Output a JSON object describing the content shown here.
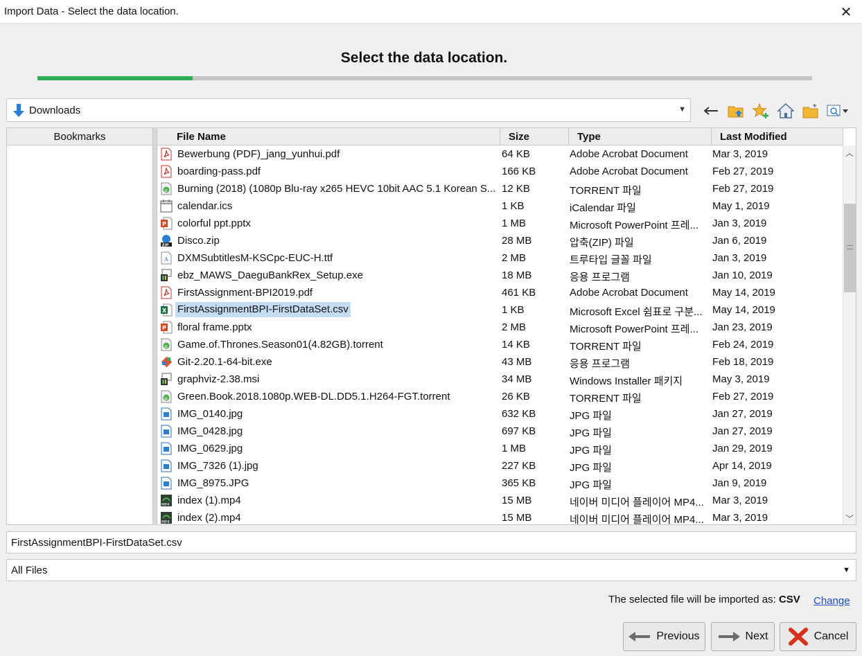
{
  "window": {
    "title": "Import Data - Select the data location."
  },
  "header": {
    "step_title": "Select the data location.",
    "progress_fraction": 0.2
  },
  "location": {
    "current": "Downloads"
  },
  "bookmarks": {
    "header": "Bookmarks"
  },
  "table": {
    "columns": [
      "File Name",
      "Size",
      "Type",
      "Last Modified"
    ],
    "rows": [
      {
        "name": "Bewerbung (PDF)_jang_yunhui.pdf",
        "size": "64 KB",
        "type": "Adobe Acrobat Document",
        "modified": "Mar 3, 2019",
        "icon": "pdf"
      },
      {
        "name": "boarding-pass.pdf",
        "size": "166 KB",
        "type": "Adobe Acrobat Document",
        "modified": "Feb 27, 2019",
        "icon": "pdf"
      },
      {
        "name": "Burning (2018) (1080p Blu-ray x265 HEVC 10bit AAC 5.1 Korean S...",
        "size": "12 KB",
        "type": "TORRENT 파일",
        "modified": "Feb 27, 2019",
        "icon": "torrent"
      },
      {
        "name": "calendar.ics",
        "size": "1 KB",
        "type": "iCalendar 파일",
        "modified": "May 1, 2019",
        "icon": "calendar"
      },
      {
        "name": "colorful ppt.pptx",
        "size": "1 MB",
        "type": "Microsoft PowerPoint 프레...",
        "modified": "Jan 3, 2019",
        "icon": "pptx"
      },
      {
        "name": "Disco.zip",
        "size": "28 MB",
        "type": "압축(ZIP) 파일",
        "modified": "Jan 6, 2019",
        "icon": "zip"
      },
      {
        "name": "DXMSubtitlesM-KSCpc-EUC-H.ttf",
        "size": "2 MB",
        "type": "트루타입 글꼴 파일",
        "modified": "Jan 3, 2019",
        "icon": "font"
      },
      {
        "name": "ebz_MAWS_DaeguBankRex_Setup.exe",
        "size": "18 MB",
        "type": "응용 프로그램",
        "modified": "Jan 10, 2019",
        "icon": "installer"
      },
      {
        "name": "FirstAssignment-BPI2019.pdf",
        "size": "461 KB",
        "type": "Adobe Acrobat Document",
        "modified": "May 14, 2019",
        "icon": "pdf"
      },
      {
        "name": "FirstAssignmentBPI-FirstDataSet.csv",
        "size": "1 KB",
        "type": "Microsoft Excel 쉼표로 구분...",
        "modified": "May 14, 2019",
        "icon": "csv",
        "selected": true
      },
      {
        "name": "floral frame.pptx",
        "size": "2 MB",
        "type": "Microsoft PowerPoint 프레...",
        "modified": "Jan 23, 2019",
        "icon": "pptx"
      },
      {
        "name": "Game.of.Thrones.Season01(4.82GB).torrent",
        "size": "14 KB",
        "type": "TORRENT 파일",
        "modified": "Feb 24, 2019",
        "icon": "torrent"
      },
      {
        "name": "Git-2.20.1-64-bit.exe",
        "size": "43 MB",
        "type": "응용 프로그램",
        "modified": "Feb 18, 2019",
        "icon": "git"
      },
      {
        "name": "graphviz-2.38.msi",
        "size": "34 MB",
        "type": "Windows Installer 패키지",
        "modified": "May 3, 2019",
        "icon": "installer"
      },
      {
        "name": "Green.Book.2018.1080p.WEB-DL.DD5.1.H264-FGT.torrent",
        "size": "26 KB",
        "type": "TORRENT 파일",
        "modified": "Feb 27, 2019",
        "icon": "torrent"
      },
      {
        "name": "IMG_0140.jpg",
        "size": "632 KB",
        "type": "JPG 파일",
        "modified": "Jan 27, 2019",
        "icon": "image"
      },
      {
        "name": "IMG_0428.jpg",
        "size": "697 KB",
        "type": "JPG 파일",
        "modified": "Jan 27, 2019",
        "icon": "image"
      },
      {
        "name": "IMG_0629.jpg",
        "size": "1 MB",
        "type": "JPG 파일",
        "modified": "Jan 29, 2019",
        "icon": "image"
      },
      {
        "name": "IMG_7326 (1).jpg",
        "size": "227 KB",
        "type": "JPG 파일",
        "modified": "Apr 14, 2019",
        "icon": "image"
      },
      {
        "name": "IMG_8975.JPG",
        "size": "365 KB",
        "type": "JPG 파일",
        "modified": "Jan 9, 2019",
        "icon": "image"
      },
      {
        "name": "index (1).mp4",
        "size": "15 MB",
        "type": "네이버 미디어 플레이어 MP4...",
        "modified": "Mar 3, 2019",
        "icon": "mp4"
      },
      {
        "name": "index (2).mp4",
        "size": "15 MB",
        "type": "네이버 미디어 플레이어 MP4...",
        "modified": "Mar 3, 2019",
        "icon": "mp4"
      }
    ]
  },
  "filename_field": {
    "value": "FirstAssignmentBPI-FirstDataSet.csv"
  },
  "filter": {
    "selected": "All Files"
  },
  "import_info": {
    "prefix": "The selected file will be imported as: ",
    "format": "CSV",
    "change_label": "Change"
  },
  "buttons": {
    "previous": "Previous",
    "next": "Next",
    "cancel": "Cancel"
  },
  "colors": {
    "progress_fill": "#2fae5a",
    "selection": "#c5dcf5",
    "link": "#1a4fc4"
  }
}
